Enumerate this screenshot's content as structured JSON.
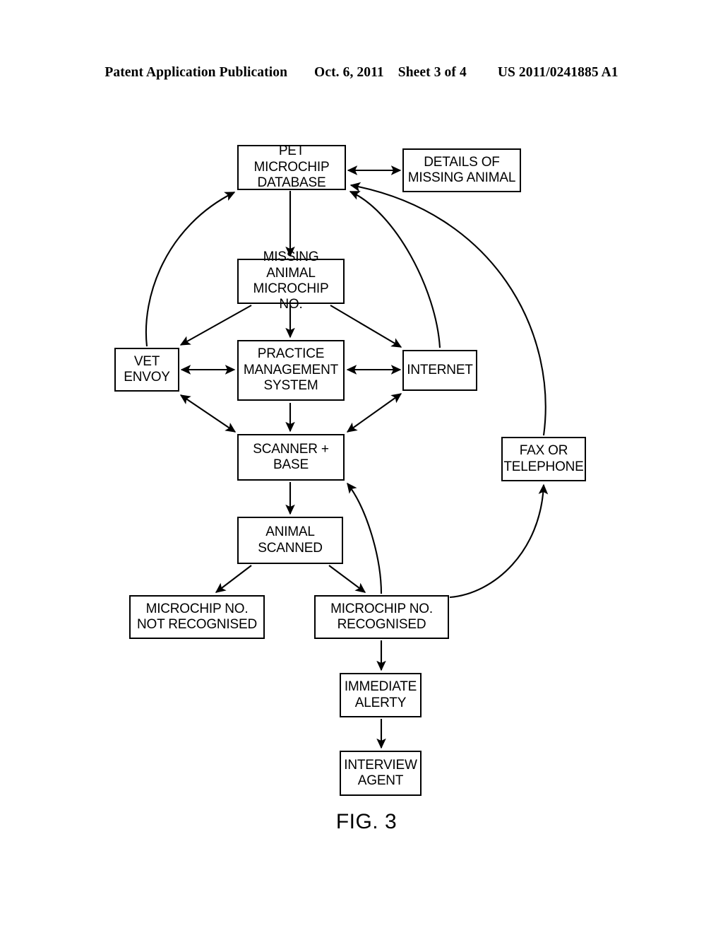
{
  "header": {
    "publication": "Patent Application Publication",
    "date": "Oct. 6, 2011",
    "sheet": "Sheet 3 of 4",
    "document_number": "US 2011/0241885 A1"
  },
  "figure": {
    "caption": "FIG. 3",
    "nodes": {
      "pet_microchip_database": "PET MICROCHIP\nDATABASE",
      "details_of_missing_animal": "DETAILS OF\nMISSING ANIMAL",
      "missing_animal_microchip_no": "MISSING ANIMAL\nMICROCHIP NO.",
      "vet_envoy": "VET\nENVOY",
      "practice_management_system": "PRACTICE\nMANAGEMENT\nSYSTEM",
      "internet": "INTERNET",
      "scanner_base": "SCANNER +\nBASE",
      "fax_or_telephone": "FAX OR\nTELEPHONE",
      "animal_scanned": "ANIMAL\nSCANNED",
      "microchip_no_not_recognised": "MICROCHIP NO.\nNOT RECOGNISED",
      "microchip_no_recognised": "MICROCHIP NO.\nRECOGNISED",
      "immediate_alerty": "IMMEDIATE\nALERTY",
      "interview_agent": "INTERVIEW\nAGENT"
    },
    "stroke_color": "#000000",
    "background_color": "#ffffff"
  },
  "chart_data": {
    "type": "diagram",
    "title": "FIG. 3",
    "nodes": [
      {
        "id": "pet_microchip_database",
        "label": "PET MICROCHIP DATABASE"
      },
      {
        "id": "details_of_missing_animal",
        "label": "DETAILS OF MISSING ANIMAL"
      },
      {
        "id": "missing_animal_microchip_no",
        "label": "MISSING ANIMAL MICROCHIP NO."
      },
      {
        "id": "vet_envoy",
        "label": "VET ENVOY"
      },
      {
        "id": "practice_management_system",
        "label": "PRACTICE MANAGEMENT SYSTEM"
      },
      {
        "id": "internet",
        "label": "INTERNET"
      },
      {
        "id": "scanner_base",
        "label": "SCANNER + BASE"
      },
      {
        "id": "fax_or_telephone",
        "label": "FAX OR TELEPHONE"
      },
      {
        "id": "animal_scanned",
        "label": "ANIMAL SCANNED"
      },
      {
        "id": "microchip_no_not_recognised",
        "label": "MICROCHIP NO. NOT RECOGNISED"
      },
      {
        "id": "microchip_no_recognised",
        "label": "MICROCHIP NO. RECOGNISED"
      },
      {
        "id": "immediate_alerty",
        "label": "IMMEDIATE ALERTY"
      },
      {
        "id": "interview_agent",
        "label": "INTERVIEW AGENT"
      }
    ],
    "edges": [
      {
        "from": "pet_microchip_database",
        "to": "details_of_missing_animal",
        "arrow": "double",
        "style": "straight"
      },
      {
        "from": "pet_microchip_database",
        "to": "missing_animal_microchip_no",
        "arrow": "single",
        "style": "straight"
      },
      {
        "from": "missing_animal_microchip_no",
        "to": "vet_envoy",
        "arrow": "single",
        "style": "straight"
      },
      {
        "from": "missing_animal_microchip_no",
        "to": "practice_management_system",
        "arrow": "single",
        "style": "straight"
      },
      {
        "from": "missing_animal_microchip_no",
        "to": "internet",
        "arrow": "single",
        "style": "straight"
      },
      {
        "from": "vet_envoy",
        "to": "practice_management_system",
        "arrow": "double",
        "style": "straight"
      },
      {
        "from": "practice_management_system",
        "to": "internet",
        "arrow": "double",
        "style": "straight"
      },
      {
        "from": "vet_envoy",
        "to": "scanner_base",
        "arrow": "double",
        "style": "straight"
      },
      {
        "from": "practice_management_system",
        "to": "scanner_base",
        "arrow": "single",
        "style": "straight"
      },
      {
        "from": "internet",
        "to": "scanner_base",
        "arrow": "double",
        "style": "straight"
      },
      {
        "from": "vet_envoy",
        "to": "pet_microchip_database",
        "arrow": "single",
        "style": "curved"
      },
      {
        "from": "internet",
        "to": "pet_microchip_database",
        "arrow": "single",
        "style": "curved"
      },
      {
        "from": "fax_or_telephone",
        "to": "pet_microchip_database",
        "arrow": "single",
        "style": "curved"
      },
      {
        "from": "scanner_base",
        "to": "animal_scanned",
        "arrow": "single",
        "style": "straight"
      },
      {
        "from": "animal_scanned",
        "to": "microchip_no_not_recognised",
        "arrow": "single",
        "style": "straight"
      },
      {
        "from": "animal_scanned",
        "to": "microchip_no_recognised",
        "arrow": "single",
        "style": "straight"
      },
      {
        "from": "microchip_no_recognised",
        "to": "scanner_base",
        "arrow": "single",
        "style": "curved"
      },
      {
        "from": "microchip_no_recognised",
        "to": "fax_or_telephone",
        "arrow": "single",
        "style": "curved"
      },
      {
        "from": "microchip_no_recognised",
        "to": "immediate_alerty",
        "arrow": "single",
        "style": "straight"
      },
      {
        "from": "immediate_alerty",
        "to": "interview_agent",
        "arrow": "single",
        "style": "straight"
      }
    ]
  }
}
